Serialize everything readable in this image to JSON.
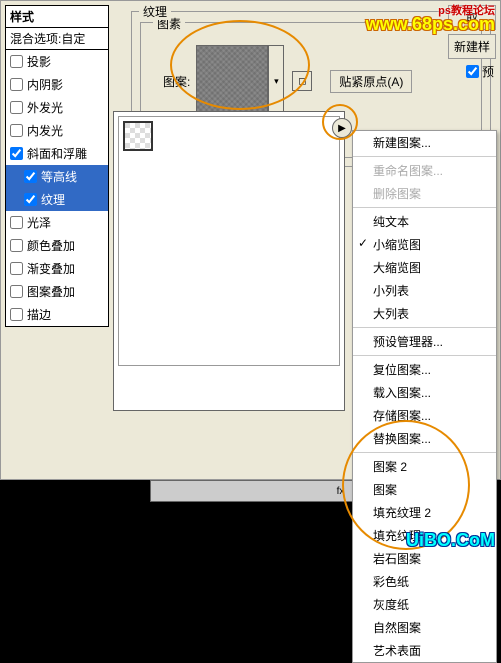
{
  "styles_panel": {
    "header": "样式",
    "blend_options": "混合选项:自定",
    "items": [
      {
        "label": "投影",
        "checked": false,
        "selected": false
      },
      {
        "label": "内阴影",
        "checked": false,
        "selected": false
      },
      {
        "label": "外发光",
        "checked": false,
        "selected": false
      },
      {
        "label": "内发光",
        "checked": false,
        "selected": false
      },
      {
        "label": "斜面和浮雕",
        "checked": true,
        "selected": false
      },
      {
        "label": "等高线",
        "checked": true,
        "selected": true,
        "indent": true
      },
      {
        "label": "纹理",
        "checked": true,
        "selected": true,
        "indent": true
      },
      {
        "label": "光泽",
        "checked": false,
        "selected": false
      },
      {
        "label": "颜色叠加",
        "checked": false,
        "selected": false
      },
      {
        "label": "渐变叠加",
        "checked": false,
        "selected": false
      },
      {
        "label": "图案叠加",
        "checked": false,
        "selected": false
      },
      {
        "label": "描边",
        "checked": false,
        "selected": false
      }
    ]
  },
  "texture": {
    "group_title": "纹理",
    "pattern_group_title": "图素",
    "pattern_label": "图案:",
    "snap_origin": "贴紧原点(A)"
  },
  "right_buttons": {
    "cancel": "取",
    "new_style": "新建样",
    "preview": "预"
  },
  "context_menu": {
    "new_pattern": "新建图案...",
    "rename": "重命名图案...",
    "delete": "删除图案",
    "text_only": "纯文本",
    "small_thumb": "小缩览图",
    "large_thumb": "大缩览图",
    "small_list": "小列表",
    "large_list": "大列表",
    "preset_mgr": "预设管理器...",
    "reset": "复位图案...",
    "load": "载入图案...",
    "save": "存储图案...",
    "replace": "替换图案...",
    "set_pattern2": "图案 2",
    "set_pattern": "图案",
    "set_fill2": "填充纹理 2",
    "set_fill": "填充纹理",
    "set_rock": "岩石图案",
    "set_color": "彩色纸",
    "set_gray": "灰度纸",
    "set_nature": "自然图案",
    "set_art": "艺术表面"
  },
  "watermarks": {
    "top_text": "ps教程论坛",
    "top_url": "www.68ps.com",
    "bottom": "UiBO.CoM"
  },
  "bottom_bar": {
    "fx": "fx"
  }
}
